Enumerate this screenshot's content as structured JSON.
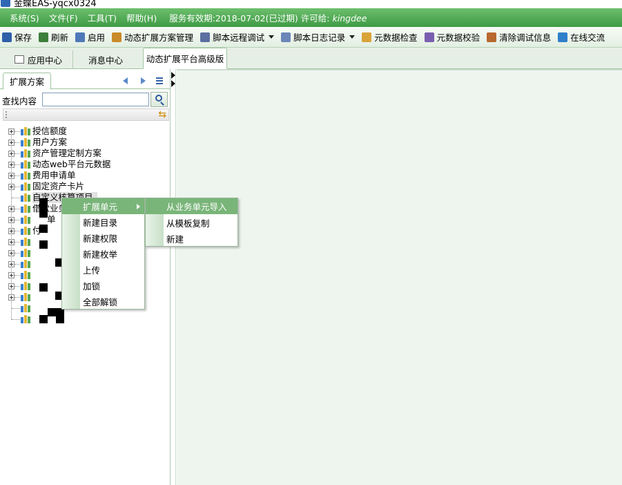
{
  "window": {
    "title": "金蝶EAS-yqcx0324"
  },
  "menubar": {
    "items": [
      "系统(S)",
      "文件(F)",
      "工具(T)",
      "帮助(H)"
    ],
    "service_info": "服务有效期:2018-07-02(已过期)",
    "license_label": "许可给:",
    "license_value": "kingdee"
  },
  "toolbar": {
    "save": "保存",
    "refresh": "刷新",
    "enable": "启用",
    "dynamic_ext_mgmt": "动态扩展方案管理",
    "script_remote_debug": "脚本远程调试",
    "script_log": "脚本日志记录",
    "metadata_check": "元数据检查",
    "metadata_verify": "元数据校验",
    "clear_debug": "清除调试信息",
    "online_chat": "在线交流"
  },
  "tabs": {
    "app_center": "应用中心",
    "message_center": "消息中心",
    "dynamic_platform": "动态扩展平台高级版"
  },
  "left_panel": {
    "tab_label": "扩展方案",
    "search_label": "查找内容",
    "search_value": "",
    "tree": [
      "授信额度",
      "用户方案",
      "资产管理定制方案",
      "动态web平台元数据",
      "费用申请单",
      "固定资产卡片",
      "自定义核算项目",
      "借款业务",
      "单",
      "付",
      "",
      "",
      "",
      "",
      "",
      "",
      "",
      "",
      ""
    ]
  },
  "context_menu": {
    "items": [
      "扩展单元",
      "新建目录",
      "新建权限",
      "新建枚举",
      "上传",
      "加锁",
      "全部解锁"
    ],
    "submenu": [
      "从业务单元导入",
      "从模板复制",
      "新建"
    ]
  },
  "colors": {
    "menubar_green": "#4fae55",
    "highlight_green": "#79b579",
    "panel_bg": "#eef5ee"
  }
}
